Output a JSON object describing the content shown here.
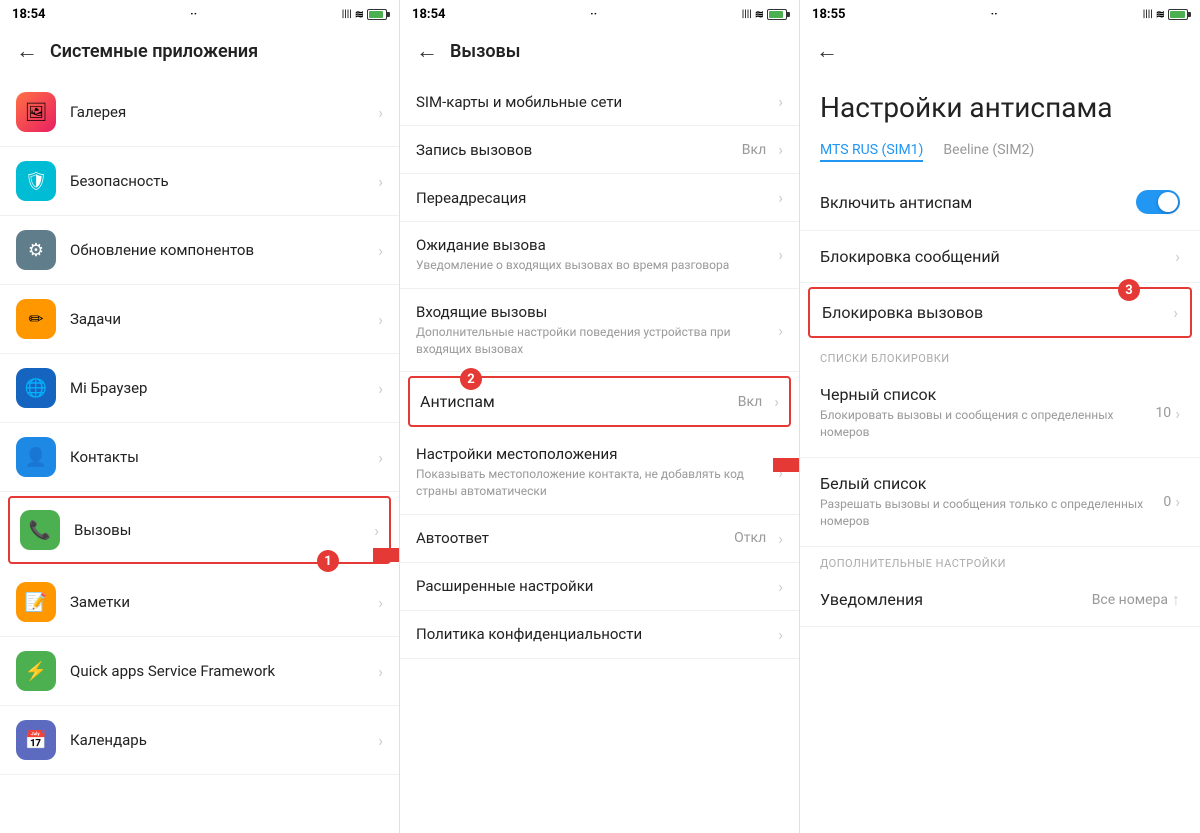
{
  "panel1": {
    "statusBar": {
      "time": "18:54",
      "dots": "··",
      "icons": "📶 ≋ 🔋"
    },
    "header": {
      "backLabel": "←",
      "title": "Системные приложения"
    },
    "items": [
      {
        "id": "gallery",
        "icon": "🖼",
        "iconClass": "icon-gallery",
        "title": "Галерея",
        "arrow": "›"
      },
      {
        "id": "security",
        "icon": "🛡",
        "iconClass": "icon-security",
        "title": "Безопасность",
        "arrow": "›"
      },
      {
        "id": "update",
        "icon": "⚙",
        "iconClass": "icon-update",
        "title": "Обновление компонентов",
        "arrow": "›"
      },
      {
        "id": "tasks",
        "icon": "✏",
        "iconClass": "icon-tasks",
        "title": "Задачи",
        "arrow": "›"
      },
      {
        "id": "browser",
        "icon": "🌐",
        "iconClass": "icon-browser",
        "title": "Mi Браузер",
        "arrow": "›"
      },
      {
        "id": "contacts",
        "icon": "👤",
        "iconClass": "icon-contacts",
        "title": "Контакты",
        "arrow": "›"
      },
      {
        "id": "calls",
        "icon": "📞",
        "iconClass": "icon-calls",
        "title": "Вызовы",
        "arrow": "›",
        "highlighted": true
      },
      {
        "id": "notes",
        "icon": "📝",
        "iconClass": "icon-notes",
        "title": "Заметки",
        "arrow": "›"
      },
      {
        "id": "quick",
        "icon": "⚡",
        "iconClass": "icon-quick",
        "title": "Quick apps Service Framework",
        "arrow": "›"
      },
      {
        "id": "calendar",
        "icon": "📅",
        "iconClass": "icon-calendar",
        "title": "Календарь",
        "arrow": "›"
      }
    ],
    "badge1": "1"
  },
  "panel2": {
    "statusBar": {
      "time": "18:54",
      "dots": "··"
    },
    "header": {
      "backLabel": "←",
      "title": "Вызовы"
    },
    "items": [
      {
        "id": "sim",
        "title": "SIM-карты и мобильные сети",
        "arrow": "›"
      },
      {
        "id": "record",
        "title": "Запись вызовов",
        "value": "Вкл",
        "arrow": "›"
      },
      {
        "id": "forward",
        "title": "Переадресация",
        "arrow": "›"
      },
      {
        "id": "waiting",
        "title": "Ожидание вызова",
        "subtitle": "Уведомление о входящих вызовах во время разговора",
        "arrow": "›"
      },
      {
        "id": "incoming",
        "title": "Входящие вызовы",
        "subtitle": "Дополнительные настройки поведения устройства при входящих вызовах",
        "arrow": "›"
      },
      {
        "id": "antispam",
        "title": "Антиспам",
        "value": "Вкл",
        "arrow": "›",
        "highlighted": true
      },
      {
        "id": "location",
        "title": "Настройки местоположения",
        "subtitle": "Показывать местоположение контакта, не добавлять код страны автоматически",
        "arrow": "›"
      },
      {
        "id": "autoanswer",
        "title": "Автоответ",
        "value": "Откл",
        "arrow": "›"
      },
      {
        "id": "advanced",
        "title": "Расширенные настройки",
        "arrow": "›"
      },
      {
        "id": "privacy",
        "title": "Политика конфиденциальности",
        "arrow": "›"
      }
    ],
    "badge2": "2"
  },
  "panel3": {
    "statusBar": {
      "time": "18:55",
      "dots": "··"
    },
    "header": {
      "backLabel": "←"
    },
    "title": "Настройки\nантиспама",
    "simTabs": [
      {
        "id": "sim1",
        "label": "MTS RUS (SIM1)",
        "active": true
      },
      {
        "id": "sim2",
        "label": "Beeline (SIM2)",
        "active": false
      }
    ],
    "toggleItem": {
      "title": "Включить антиспам",
      "enabled": true
    },
    "blockSection": {
      "items": [
        {
          "id": "block-messages",
          "title": "Блокировка сообщений",
          "arrow": "›"
        },
        {
          "id": "block-calls",
          "title": "Блокировка вызовов",
          "arrow": "›",
          "highlighted": true
        }
      ]
    },
    "blockListsLabel": "СПИСКИ БЛОКИРОВКИ",
    "blockLists": [
      {
        "id": "blacklist",
        "title": "Черный список",
        "subtitle": "Блокировать вызовы и сообщения с определенных номеров",
        "value": "10",
        "arrow": "›"
      },
      {
        "id": "whitelist",
        "title": "Белый список",
        "subtitle": "Разрешать вызовы и сообщения только с определенных номеров",
        "value": "0",
        "arrow": "›"
      }
    ],
    "additionalLabel": "ДОПОЛНИТЕЛЬНЫЕ НАСТРОЙКИ",
    "additionalItems": [
      {
        "id": "notifications",
        "title": "Уведомления",
        "value": "Все номера",
        "arrow": "↑"
      }
    ],
    "badge3": "3"
  },
  "arrow1Label": "→",
  "arrow2Label": "→"
}
